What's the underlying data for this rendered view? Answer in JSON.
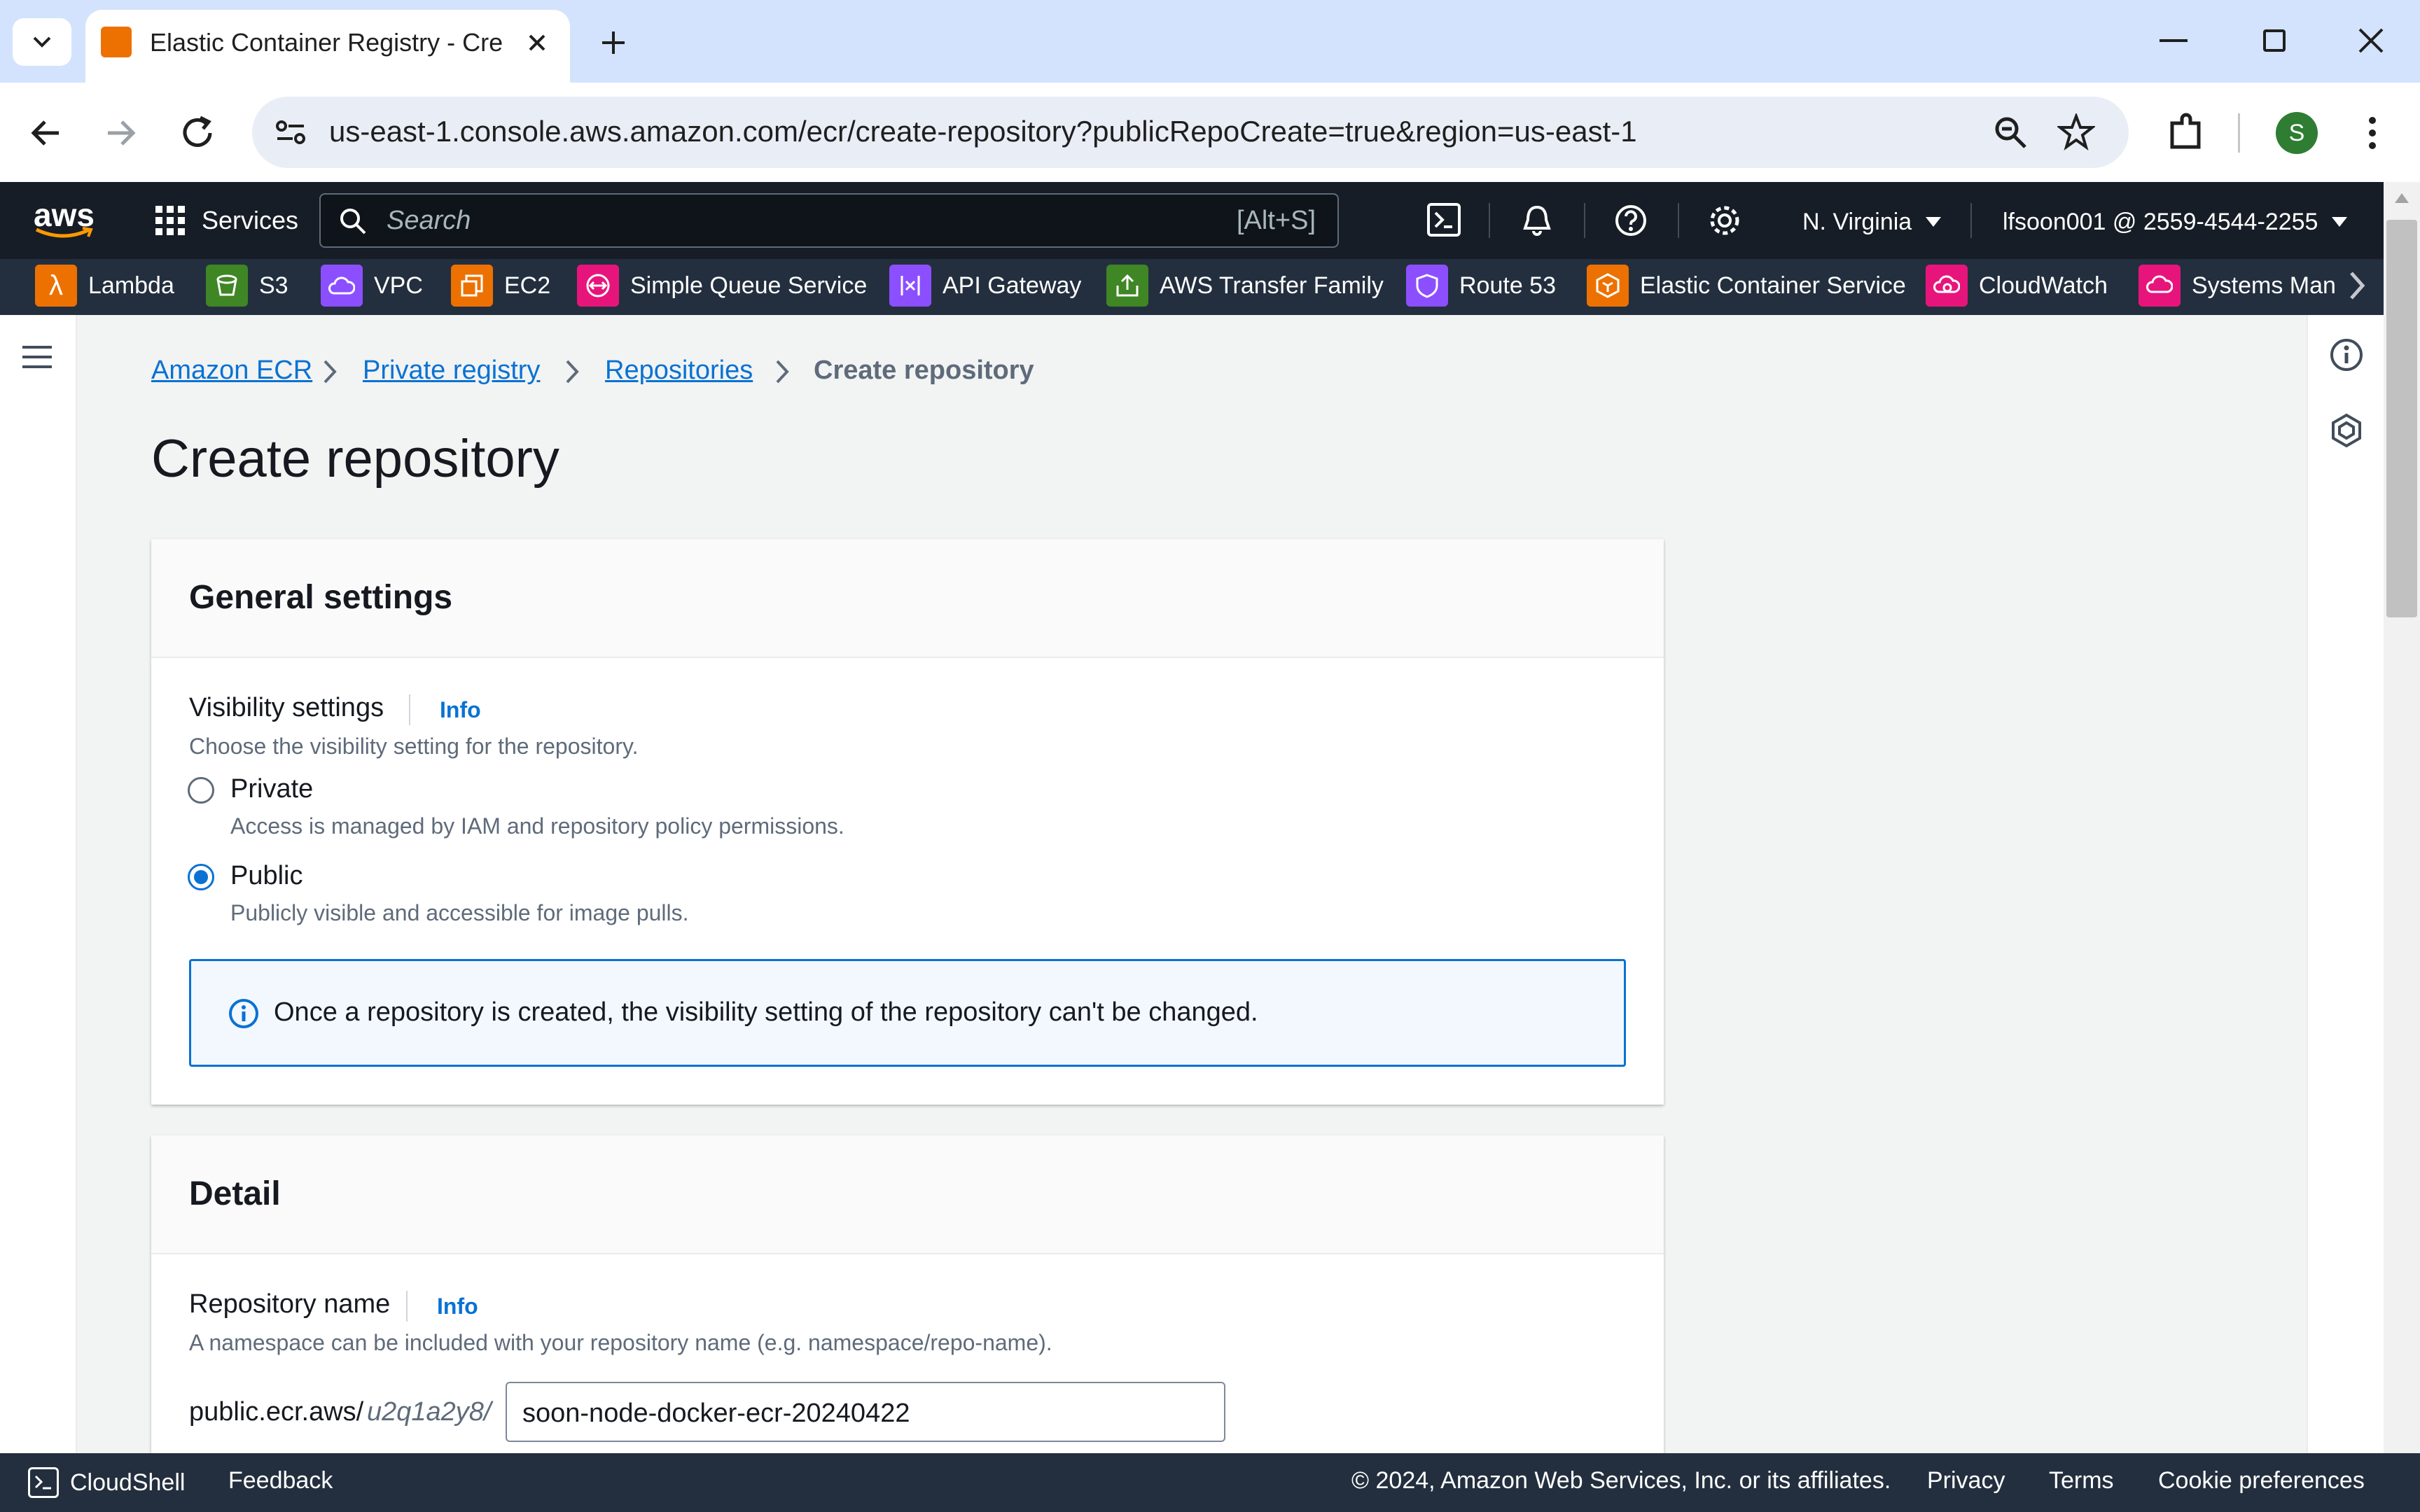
{
  "browser": {
    "tab_title": "Elastic Container Registry - Cre",
    "url": "us-east-1.console.aws.amazon.com/ecr/create-repository?publicRepoCreate=true&region=us-east-1",
    "profile_initial": "S"
  },
  "aws_nav": {
    "logo": "aws",
    "services_label": "Services",
    "search_placeholder": "Search",
    "search_shortcut": "[Alt+S]",
    "region": "N. Virginia",
    "account": "lfsoon001 @ 2559-4544-2255",
    "favorites": [
      {
        "label": "Lambda",
        "color": "#ed7100"
      },
      {
        "label": "S3",
        "color": "#3f8624"
      },
      {
        "label": "VPC",
        "color": "#8c4fff"
      },
      {
        "label": "EC2",
        "color": "#ed7100"
      },
      {
        "label": "Simple Queue Service",
        "color": "#e7157b"
      },
      {
        "label": "API Gateway",
        "color": "#8c4fff"
      },
      {
        "label": "AWS Transfer Family",
        "color": "#3f8624"
      },
      {
        "label": "Route 53",
        "color": "#8c4fff"
      },
      {
        "label": "Elastic Container Service",
        "color": "#ed7100"
      },
      {
        "label": "CloudWatch",
        "color": "#e7157b"
      },
      {
        "label": "Systems Man",
        "color": "#e7157b"
      }
    ]
  },
  "breadcrumb": {
    "items": [
      "Amazon ECR",
      "Private registry",
      "Repositories",
      "Create repository"
    ]
  },
  "page": {
    "title": "Create repository"
  },
  "general_settings": {
    "heading": "General settings",
    "visibility_label": "Visibility settings",
    "info": "Info",
    "visibility_desc": "Choose the visibility setting for the repository.",
    "options": [
      {
        "label": "Private",
        "desc": "Access is managed by IAM and repository policy permissions.",
        "selected": false
      },
      {
        "label": "Public",
        "desc": "Publicly visible and accessible for image pulls.",
        "selected": true
      }
    ],
    "alert": "Once a repository is created, the visibility setting of the repository can't be changed."
  },
  "detail": {
    "heading": "Detail",
    "repo_name_label": "Repository name",
    "info": "Info",
    "repo_name_desc": "A namespace can be included with your repository name (e.g. namespace/repo-name).",
    "prefix": "public.ecr.aws/",
    "alias": "u2q1a2y8/",
    "repo_name_value": "soon-node-docker-ecr-20240422"
  },
  "footer": {
    "cloudshell": "CloudShell",
    "feedback": "Feedback",
    "copyright": "© 2024, Amazon Web Services, Inc. or its affiliates.",
    "privacy": "Privacy",
    "terms": "Terms",
    "cookie": "Cookie preferences"
  }
}
